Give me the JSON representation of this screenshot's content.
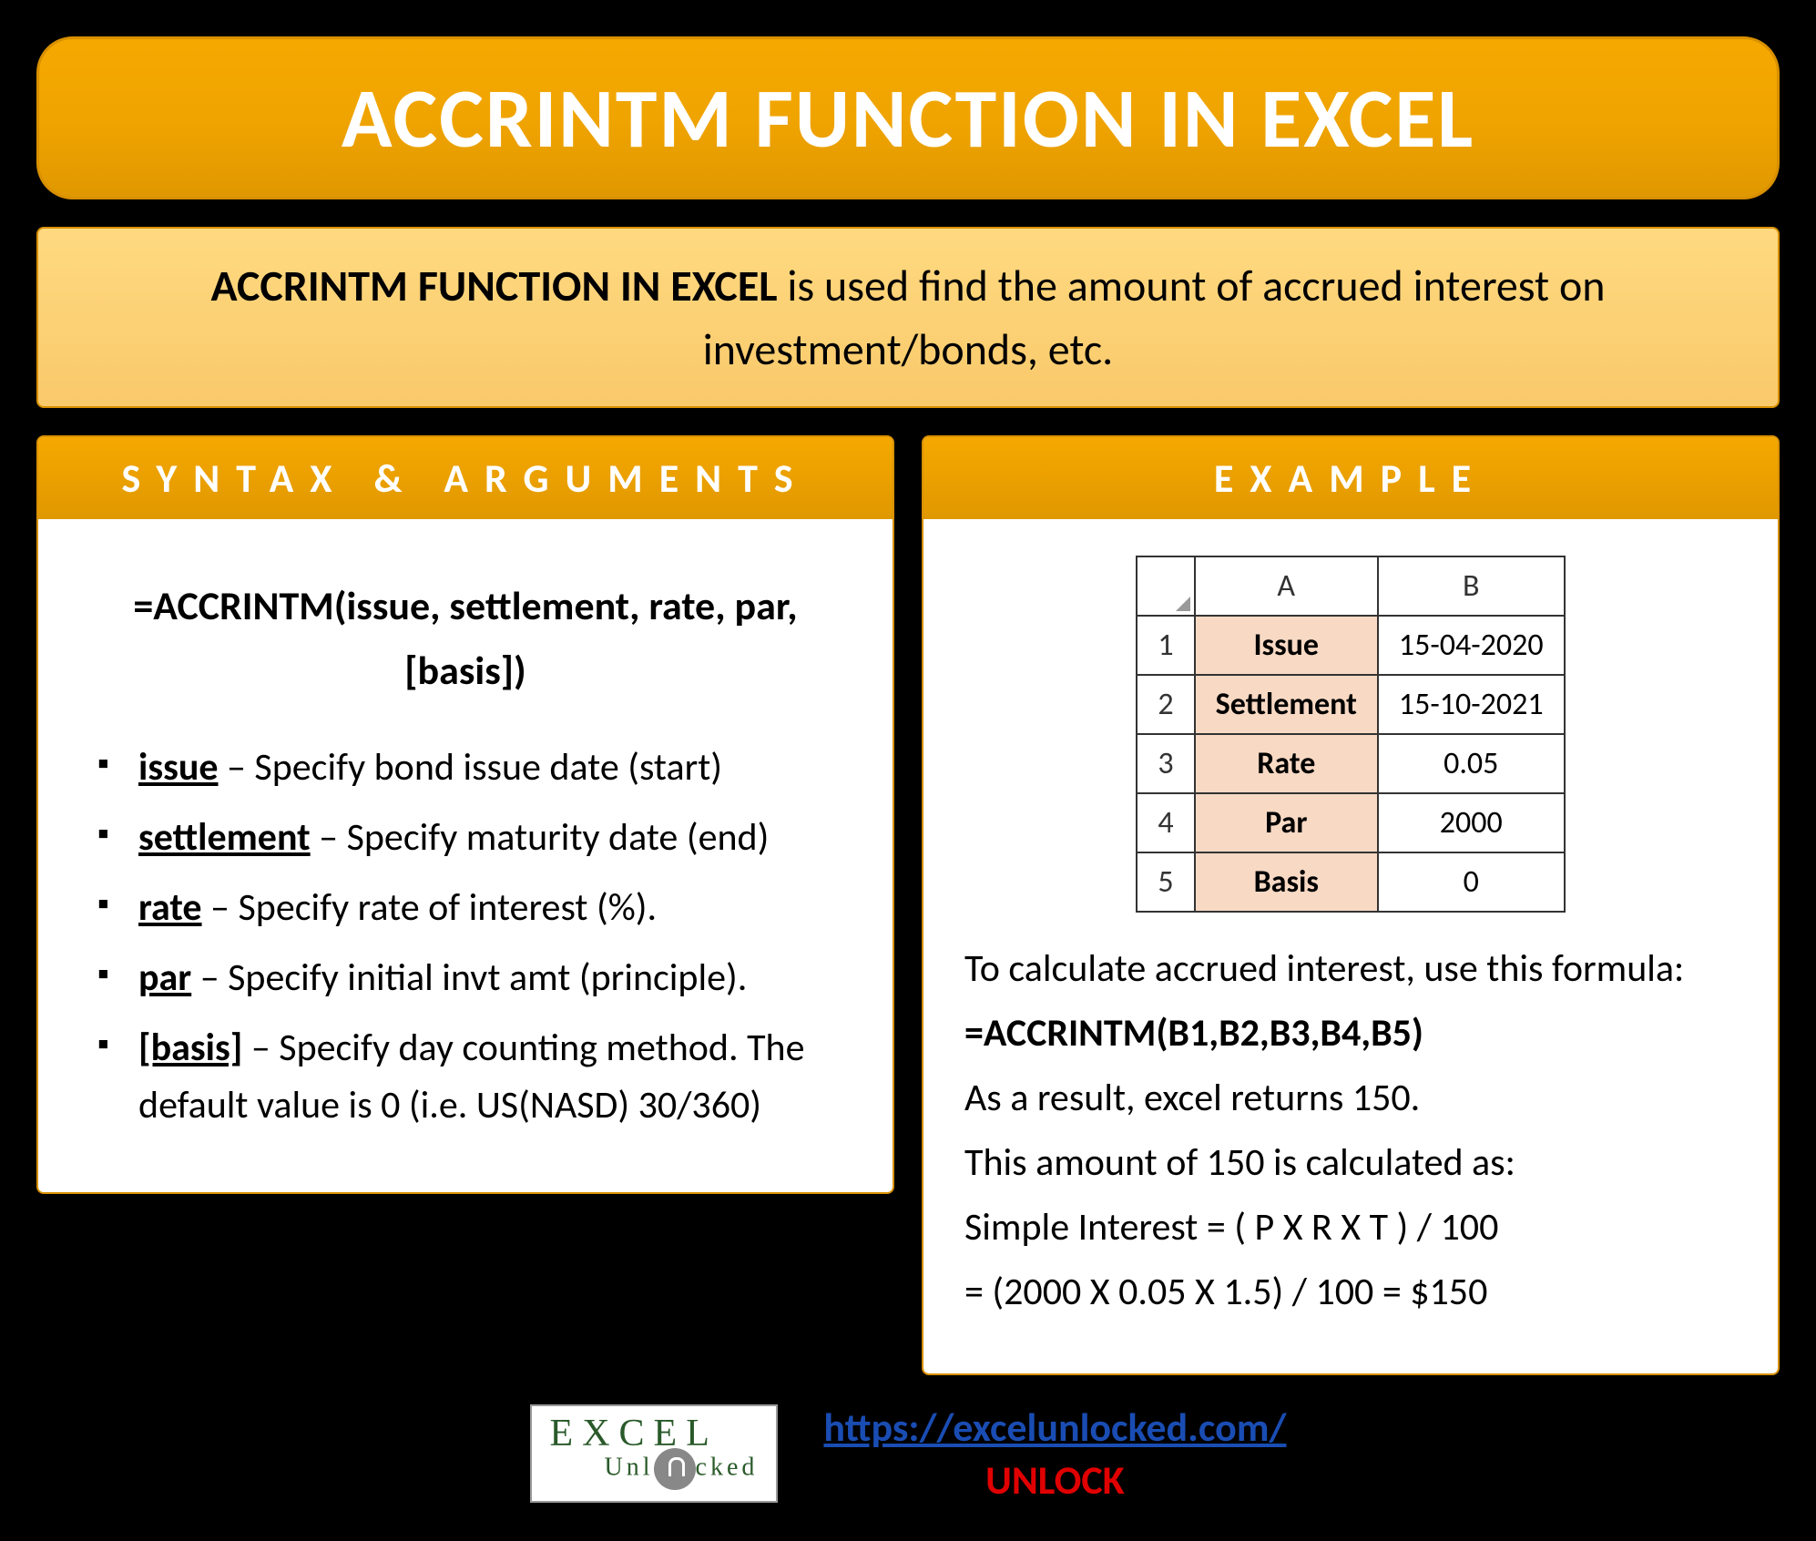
{
  "title": "ACCRINTM FUNCTION IN EXCEL",
  "intro": {
    "lead": "ACCRINTM FUNCTION IN EXCEL",
    "rest": " is used find the amount of accrued interest on investment/bonds, etc."
  },
  "syntax_panel": {
    "header": "SYNTAX & ARGUMENTS",
    "formula": "=ACCRINTM(issue, settlement, rate, par, [basis])",
    "args": [
      {
        "name": "issue",
        "desc": " – Specify bond issue date (start)"
      },
      {
        "name": "settlement",
        "desc": " – Specify maturity date (end)"
      },
      {
        "name": "rate",
        "desc": " – Specify rate of interest (%)."
      },
      {
        "name": "par",
        "desc": " – Specify initial invt amt (principle)."
      },
      {
        "name": "[basis]",
        "desc": " – Specify day counting method. The default value is 0 (i.e. US(NASD) 30/360)"
      }
    ]
  },
  "example_panel": {
    "header": "EXAMPLE",
    "table": {
      "col_a": "A",
      "col_b": "B",
      "rows": [
        {
          "n": "1",
          "label": "Issue",
          "value": "15-04-2020"
        },
        {
          "n": "2",
          "label": "Settlement",
          "value": "15-10-2021"
        },
        {
          "n": "3",
          "label": "Rate",
          "value": "0.05"
        },
        {
          "n": "4",
          "label": "Par",
          "value": "2000"
        },
        {
          "n": "5",
          "label": "Basis",
          "value": "0"
        }
      ]
    },
    "lines": {
      "l1": "To calculate accrued interest, use this formula:",
      "l2": "=ACCRINTM(B1,B2,B3,B4,B5)",
      "l3": "As a result, excel returns 150.",
      "l4": "This amount of 150 is calculated as:",
      "l5": "Simple Interest = ( P X R X T ) / 100",
      "l6": "= (2000 X 0.05 X 1.5) / 100 = $150"
    }
  },
  "footer": {
    "logo_main": "EXCEL",
    "logo_sub": "Unlocked",
    "link": "https://excelunlocked.com/",
    "unlock": "UNLOCK"
  }
}
